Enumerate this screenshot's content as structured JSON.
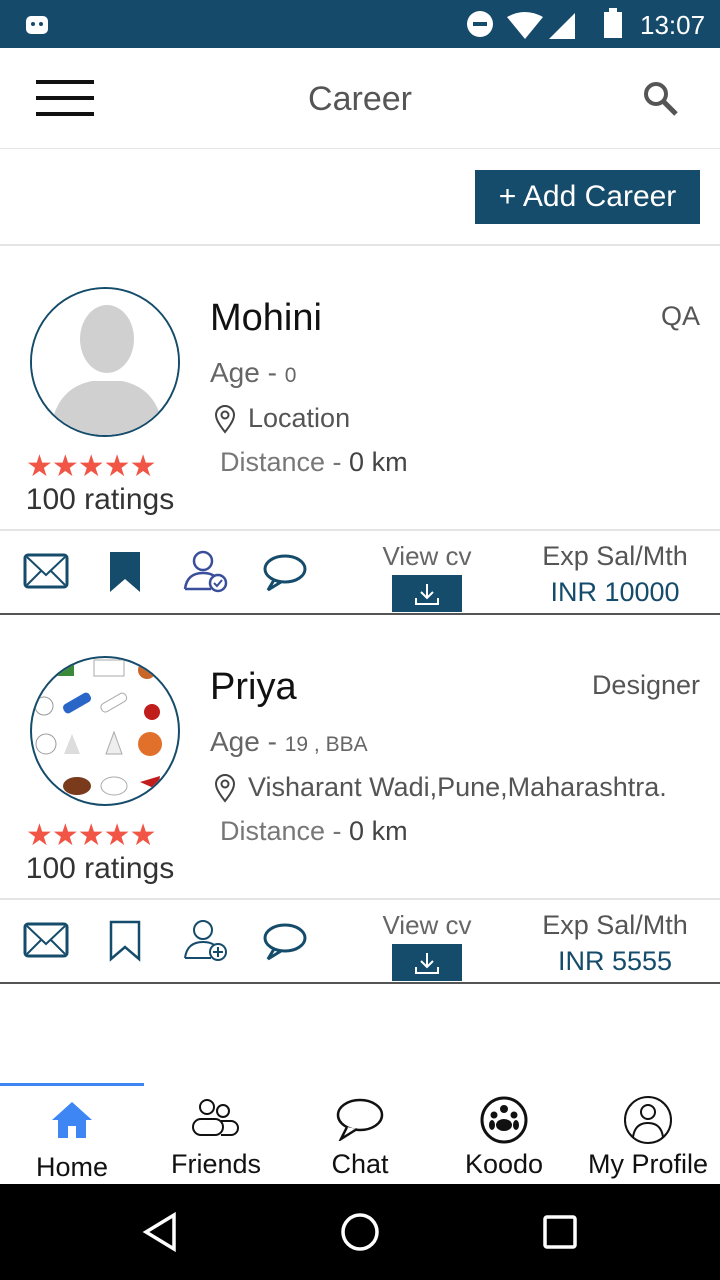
{
  "status_bar": {
    "time": "13:07"
  },
  "header": {
    "title": "Career",
    "menu_icon": "hamburger-icon",
    "search_icon": "search-icon"
  },
  "add_button": {
    "label": "+ Add Career"
  },
  "colors": {
    "primary": "#154c6b",
    "star": "#f05545",
    "active_tab": "#3f86f5"
  },
  "cards": [
    {
      "name": "Mohini",
      "role": "QA",
      "age_label": "Age - ",
      "age": "0",
      "location": "Location",
      "distance_label": "Distance - ",
      "distance": "0 km",
      "stars": "★★★★★",
      "rating": 5,
      "ratings": "100 ratings",
      "view_cv": "View cv",
      "salary_label": "Exp Sal/Mth",
      "salary": "INR 10000",
      "bookmarked": true,
      "connection": "connected"
    },
    {
      "name": "Priya",
      "role": "Designer",
      "age_label": "Age - ",
      "age": "19 , BBA",
      "location": "Visharant Wadi,Pune,Maharashtra.",
      "distance_label": "Distance - ",
      "distance": "0 km",
      "stars": "★★★★★",
      "rating": 5,
      "ratings": "100 ratings",
      "view_cv": "View cv",
      "salary_label": "Exp Sal/Mth",
      "salary": "INR 5555",
      "bookmarked": false,
      "connection": "add"
    }
  ],
  "nav": [
    {
      "label": "Home",
      "active": true
    },
    {
      "label": "Friends"
    },
    {
      "label": "Chat"
    },
    {
      "label": "Koodo"
    },
    {
      "label": "My Profile"
    }
  ]
}
